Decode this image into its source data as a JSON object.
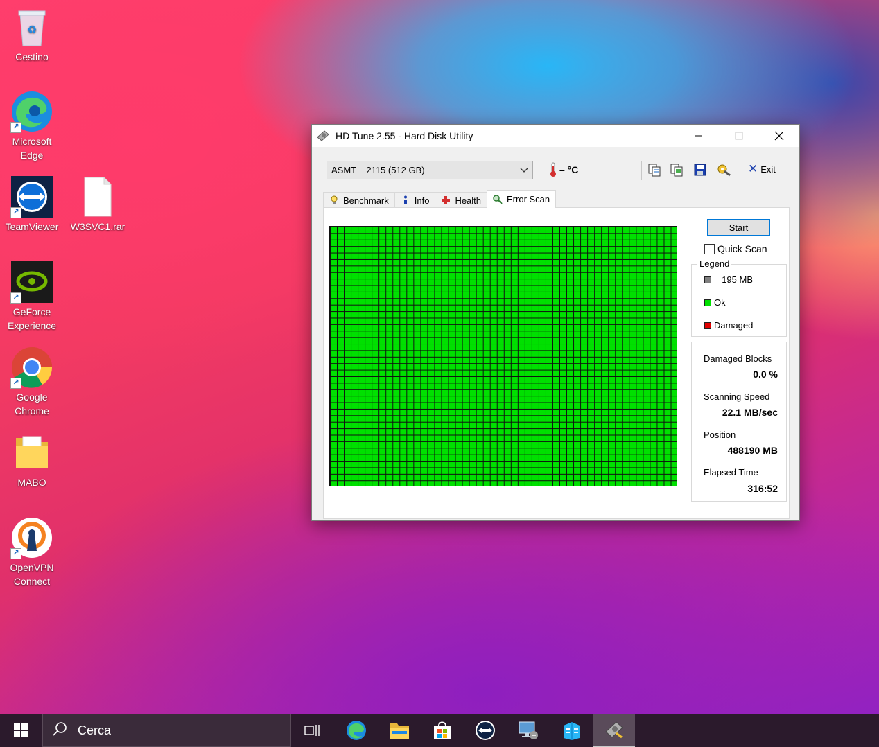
{
  "desktop": {
    "icons": [
      {
        "label": "Cestino"
      },
      {
        "label_line1": "Microsoft",
        "label_line2": "Edge"
      },
      {
        "label": "TeamViewer"
      },
      {
        "label": "W3SVC1.rar"
      },
      {
        "label_line1": "GeForce",
        "label_line2": "Experience"
      },
      {
        "label_line1": "Google",
        "label_line2": "Chrome"
      },
      {
        "label": "MABO"
      },
      {
        "label_line1": "OpenVPN",
        "label_line2": "Connect"
      }
    ]
  },
  "window": {
    "title": "HD Tune 2.55 - Hard Disk Utility",
    "drive": "ASMT    2115 (512 GB)",
    "temperature": "– °C",
    "exit_label": "Exit",
    "tabs": [
      {
        "label": "Benchmark",
        "icon": "lightbulb-icon"
      },
      {
        "label": "Info",
        "icon": "info-icon"
      },
      {
        "label": "Health",
        "icon": "health-cross-icon"
      },
      {
        "label": "Error Scan",
        "icon": "magnifier-icon",
        "active": true
      }
    ],
    "scan": {
      "start_label": "Start",
      "quick_scan_label": "Quick Scan",
      "legend_title": "Legend",
      "legend": [
        {
          "label": "= 195 MB",
          "color": "#808080"
        },
        {
          "label": "Ok",
          "color": "#00e000"
        },
        {
          "label": "Damaged",
          "color": "#e00000"
        }
      ],
      "stats": {
        "damaged_blocks_label": "Damaged Blocks",
        "damaged_blocks_value": "0.0 %",
        "scanning_speed_label": "Scanning Speed",
        "scanning_speed_value": "22.1 MB/sec",
        "position_label": "Position",
        "position_value": "488190 MB",
        "elapsed_time_label": "Elapsed Time",
        "elapsed_time_value": "316:52"
      }
    }
  },
  "taskbar": {
    "search_placeholder": "Cerca"
  }
}
